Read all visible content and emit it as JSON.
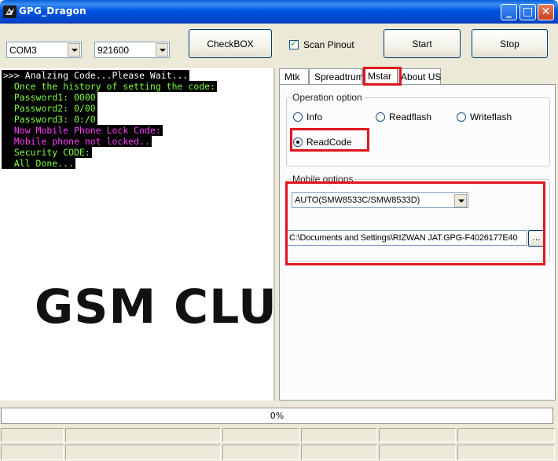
{
  "window": {
    "title": "GPG_Dragon",
    "minimize_glyph": "_",
    "maximize_glyph": "□",
    "close_glyph": "✕"
  },
  "toolbar": {
    "port_value": "COM3",
    "baud_value": "921600",
    "checkbox_button": "CheckBOX",
    "scan_pinout_label": "Scan Pinout",
    "scan_pinout_checked": true,
    "start_button": "Start",
    "stop_button": "Stop"
  },
  "console": {
    "lines": [
      {
        "text": ">>> Analzing Code...Please Wait...",
        "color": "#ffffff"
      },
      {
        "text": "  Once the history of setting the code:",
        "color": "#7fff3a"
      },
      {
        "text": "  Password1: 0000",
        "color": "#7fff3a"
      },
      {
        "text": "  Password2: 0/00",
        "color": "#7fff3a"
      },
      {
        "text": "  Password3: 0:/0",
        "color": "#7fff3a"
      },
      {
        "text": "  Now Mobile Phone Lock Code:",
        "color": "#ff40ff"
      },
      {
        "text": "  Mobile phone not locked..",
        "color": "#ff40ff"
      },
      {
        "text": "  Security CODE:",
        "color": "#7fff3a"
      },
      {
        "text": "  All Done...",
        "color": "#7fff3a"
      }
    ],
    "watermark": "GSM CLUB"
  },
  "tabs": [
    "Mtk",
    "Spreadtrum",
    "Mstar",
    "About US"
  ],
  "active_tab": "Mstar",
  "operation": {
    "group_label": "Operation option",
    "options": [
      "Info",
      "Readflash",
      "Writeflash",
      "ReadCode"
    ],
    "selected": "ReadCode"
  },
  "mobile": {
    "group_label": "Mobile options",
    "model_value": "AUTO(SMW8533C/SMW8533D)",
    "path_value": "C:\\Documents and Settings\\RIZWAN JAT.GPG-F4026177E40",
    "browse_label": "..."
  },
  "progress": {
    "value": 0,
    "label": "0%"
  },
  "colors": {
    "highlight_box": "#e0141e",
    "console_bg": "#000000"
  }
}
